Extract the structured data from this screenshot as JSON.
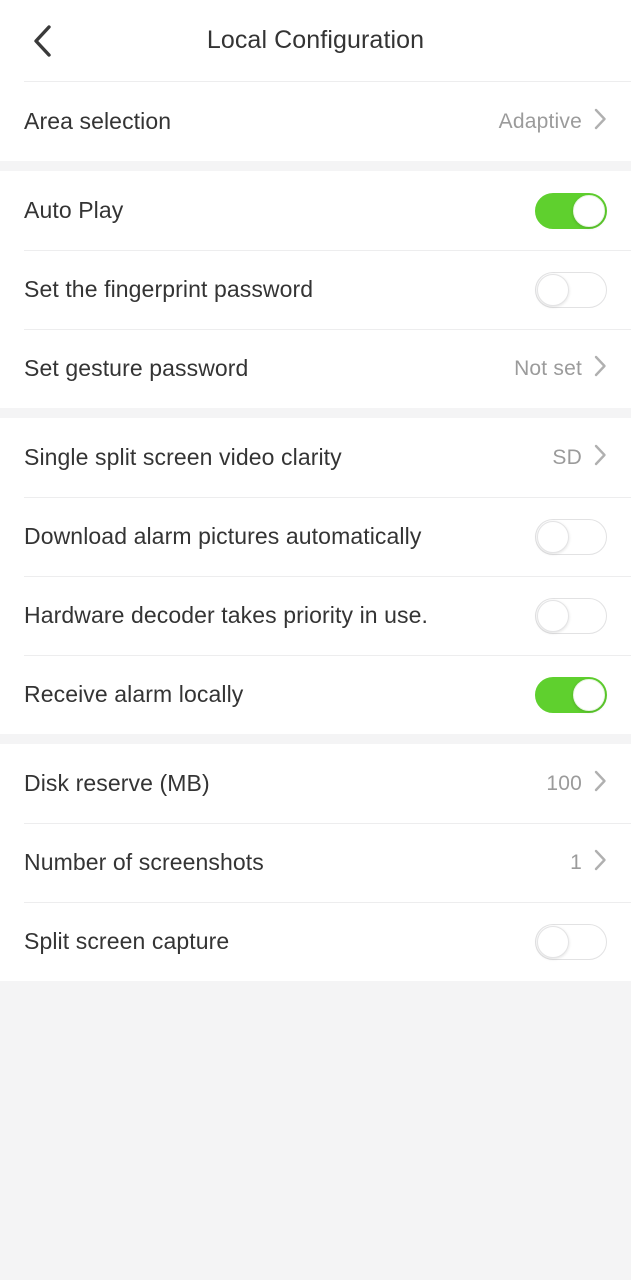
{
  "header": {
    "title": "Local Configuration",
    "back_icon": "chevron-left-icon"
  },
  "colors": {
    "toggle_on": "#5fd02e",
    "toggle_off_border": "#e2e2e3",
    "label": "#343434",
    "value": "#9b9b9b",
    "divider": "#ededee",
    "group_gap": "#f4f4f5",
    "row_background": "#ffffff"
  },
  "groups": [
    {
      "rows": [
        {
          "label": "Area selection",
          "type": "value",
          "value": "Adaptive",
          "chevron": "chevron-right-icon"
        }
      ]
    },
    {
      "rows": [
        {
          "label": "Auto Play",
          "type": "toggle",
          "state": "on"
        },
        {
          "label": "Set the fingerprint password",
          "type": "toggle",
          "state": "off"
        },
        {
          "label": "Set gesture password",
          "type": "value",
          "value": "Not set",
          "chevron": "chevron-right-icon"
        }
      ]
    },
    {
      "rows": [
        {
          "label": "Single split screen video clarity",
          "type": "value",
          "value": "SD",
          "chevron": "chevron-right-icon"
        },
        {
          "label": "Download alarm pictures automatically",
          "type": "toggle",
          "state": "off"
        },
        {
          "label": "Hardware decoder takes priority in use.",
          "type": "toggle",
          "state": "off"
        },
        {
          "label": "Receive alarm locally",
          "type": "toggle",
          "state": "on"
        }
      ]
    },
    {
      "rows": [
        {
          "label": "Disk reserve (MB)",
          "type": "value",
          "value": "100",
          "chevron": "chevron-right-icon"
        },
        {
          "label": "Number of screenshots",
          "type": "value",
          "value": "1",
          "chevron": "chevron-right-icon"
        },
        {
          "label": "Split screen capture",
          "type": "toggle",
          "state": "off"
        }
      ]
    }
  ]
}
